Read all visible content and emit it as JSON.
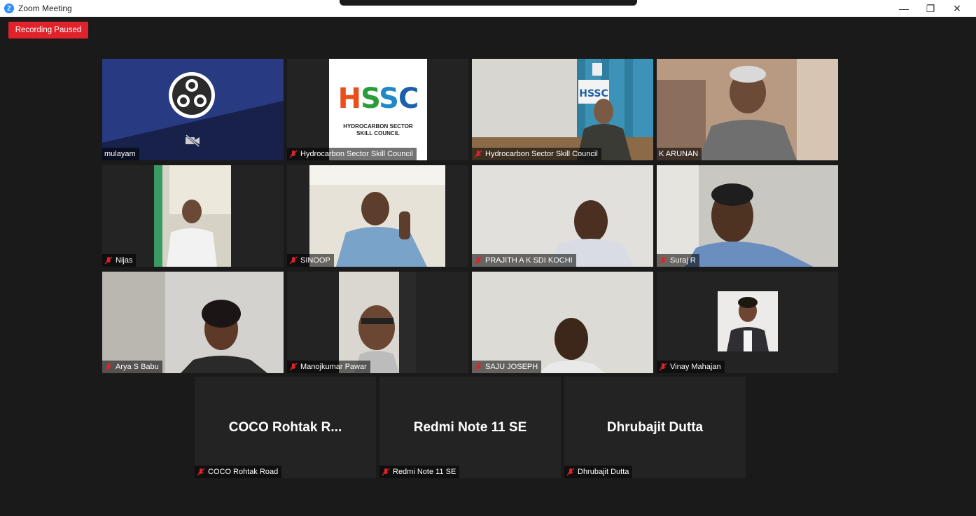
{
  "window": {
    "title": "Zoom Meeting",
    "controls": {
      "minimize": "—",
      "restore": "❐",
      "close": "✕"
    }
  },
  "recording": {
    "label": "Recording Paused"
  },
  "tiles": {
    "t1": {
      "name": "mulayam",
      "muted": false
    },
    "t2": {
      "name": "Hydrocarbon Sector Skill Council",
      "muted": true,
      "logo_text": "HSSC",
      "logo_line1": "HYDROCARBON SECTOR",
      "logo_line2": "SKILL COUNCIL"
    },
    "t3": {
      "name": "Hydrocarbon Sector Skill Council",
      "muted": true,
      "poster_text": "HSSC"
    },
    "t4": {
      "name": "K ARUNAN",
      "muted": false,
      "active_speaker": true
    },
    "t5": {
      "name": "Nijas",
      "muted": true
    },
    "t6": {
      "name": "SINOOP",
      "muted": true
    },
    "t7": {
      "name": "PRAJITH A K SDI KOCHI",
      "muted": true
    },
    "t8": {
      "name": "Suraj R",
      "muted": true
    },
    "t9": {
      "name": "Arya S Babu",
      "muted": true
    },
    "t10": {
      "name": "Manojkumar Pawar",
      "muted": true
    },
    "t11": {
      "name": "SAJU JOSEPH",
      "muted": true
    },
    "t12": {
      "name": "Vinay Mahajan",
      "muted": true
    },
    "t13": {
      "name": "COCO Rohtak Road",
      "display": "COCO Rohtak R...",
      "muted": true
    },
    "t14": {
      "name": "Redmi Note 11 SE",
      "display": "Redmi Note 11 SE",
      "muted": true
    },
    "t15": {
      "name": "Dhrubajit Dutta",
      "display": "Dhrubajit Dutta",
      "muted": true
    }
  },
  "colors": {
    "active_border": "#c6e36b",
    "recording_red": "#e0232a",
    "muted_red": "#e0232a",
    "zoom_blue": "#2d8cff"
  }
}
